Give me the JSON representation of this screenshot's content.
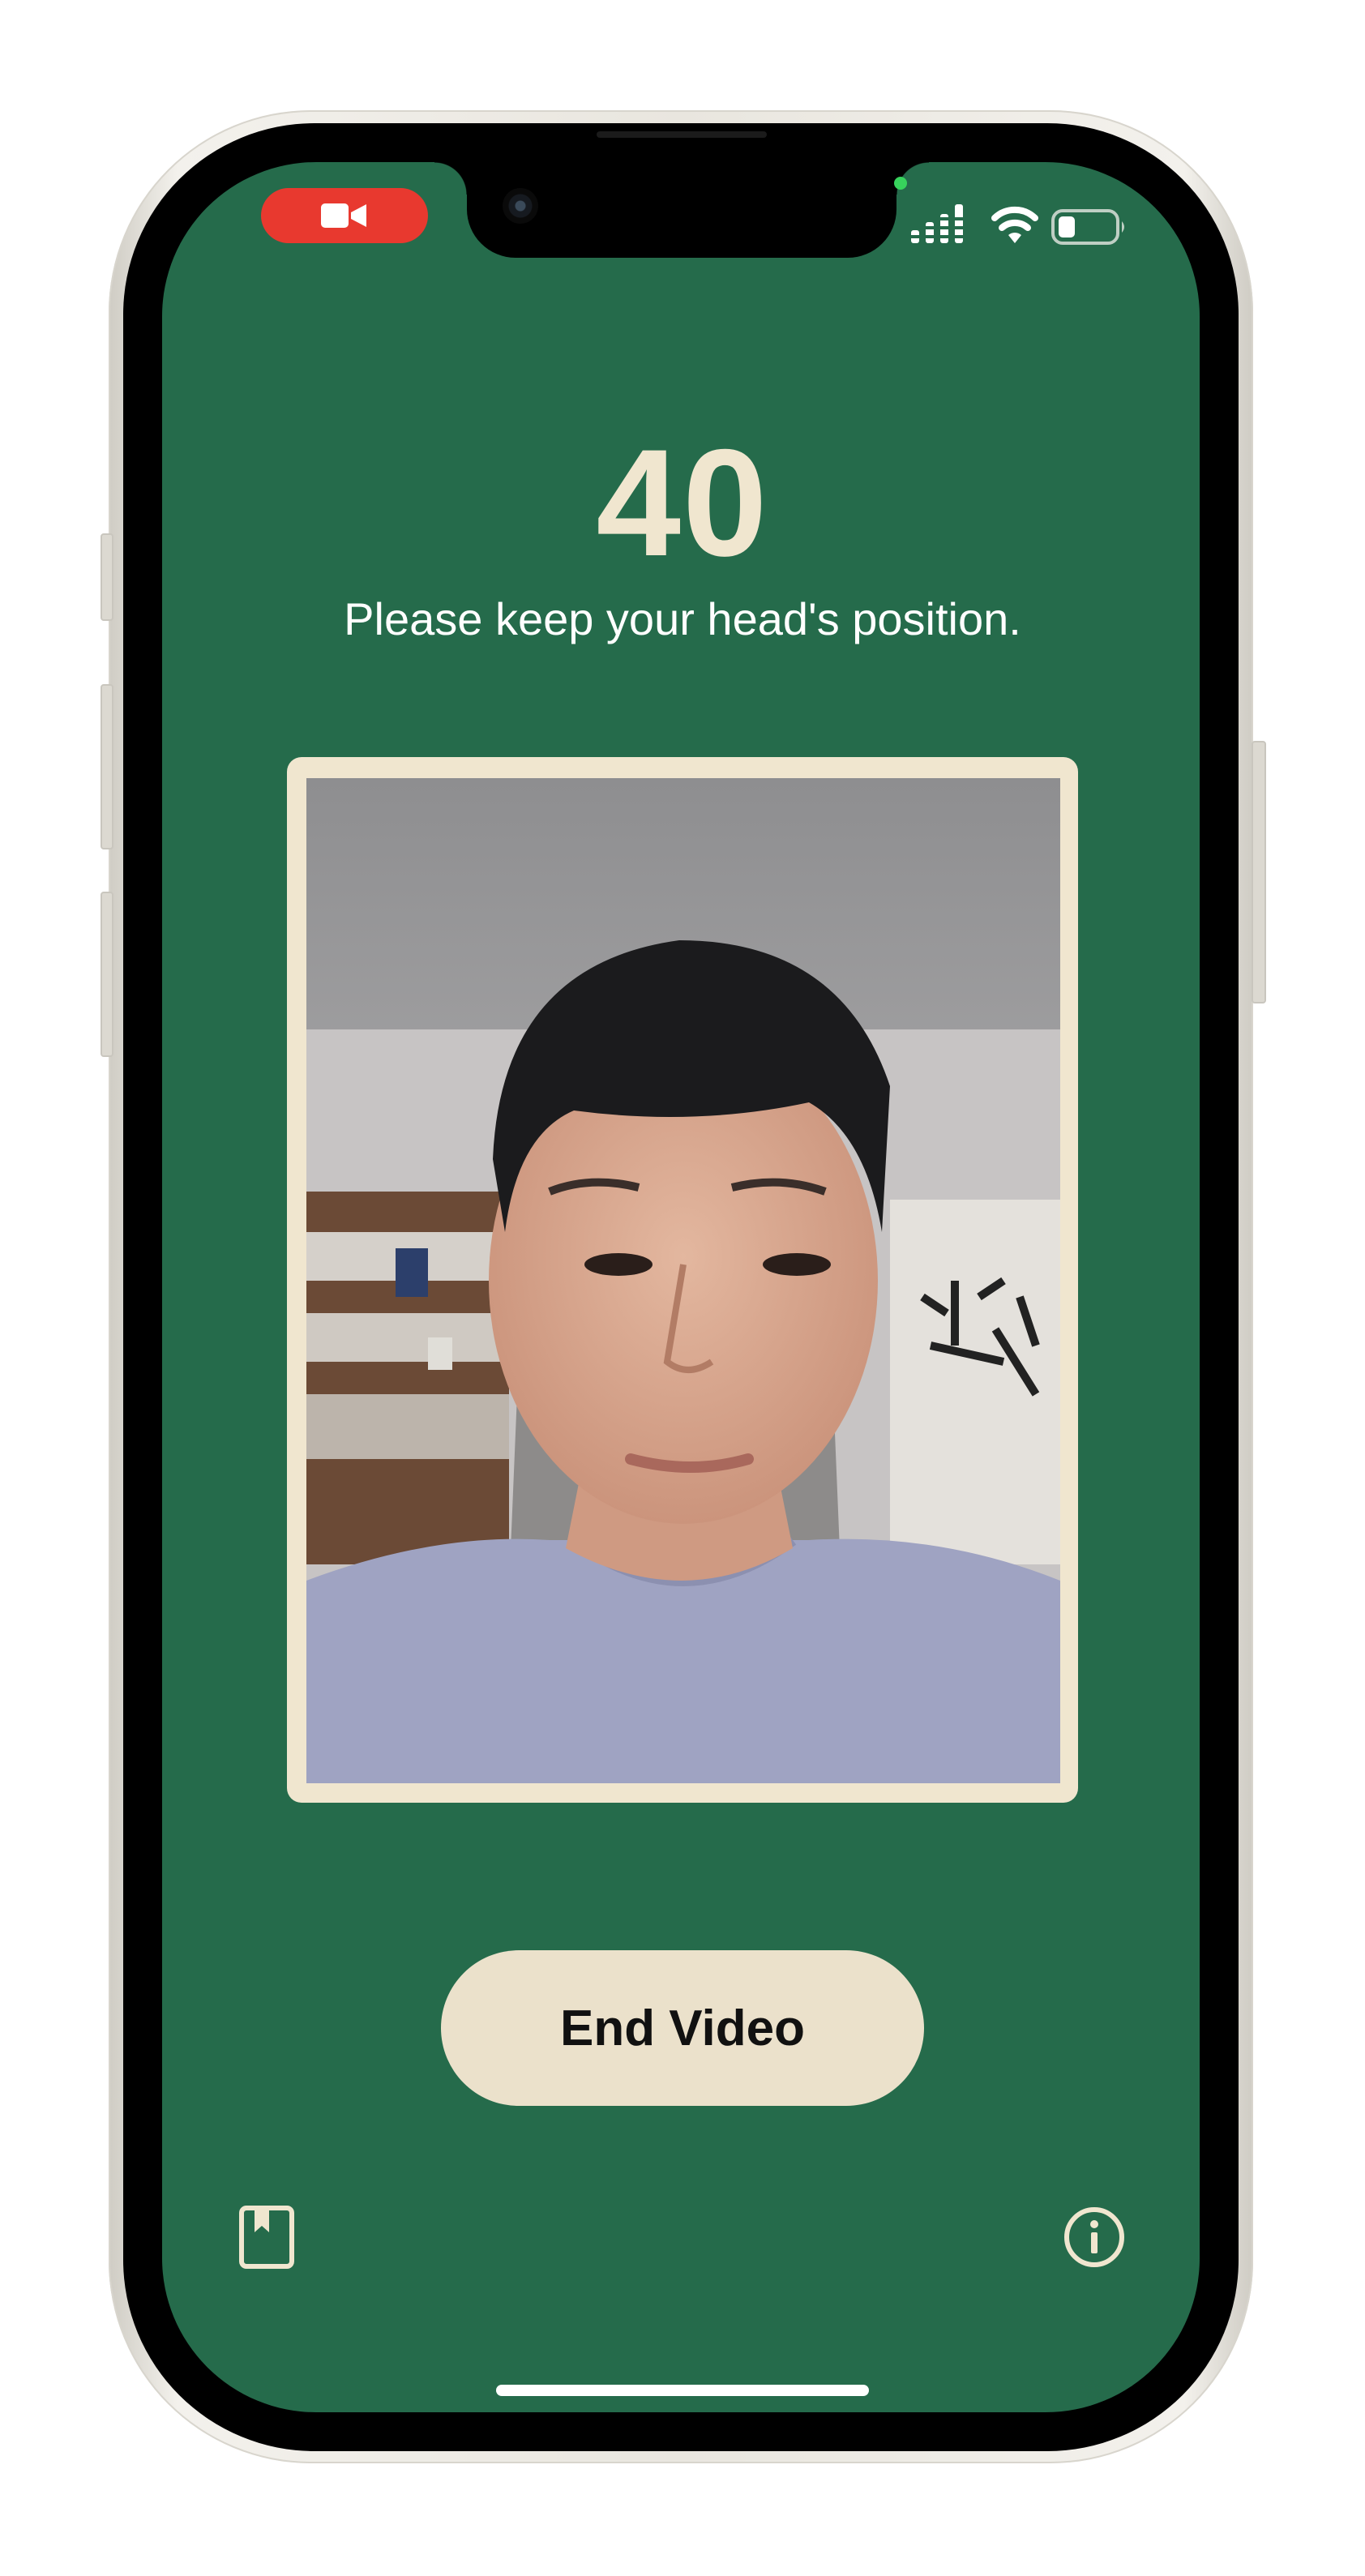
{
  "status_bar": {
    "recording_indicator_icon": "video-camera-icon",
    "signal_icon": "cellular-signal-icon",
    "wifi_icon": "wifi-icon",
    "battery_icon": "battery-icon",
    "recording_color": "#e8392f"
  },
  "session": {
    "countdown": "40",
    "instruction": "Please keep your head's position."
  },
  "video_preview": {
    "subject": "front-camera-feed"
  },
  "actions": {
    "end_video_label": "End Video"
  },
  "bottom_bar": {
    "left_icon": "bookmark-icon",
    "right_icon": "info-icon"
  },
  "theme": {
    "background": "#256b4b",
    "accent": "#f0e6cf",
    "button_bg": "#ebe1cb"
  }
}
